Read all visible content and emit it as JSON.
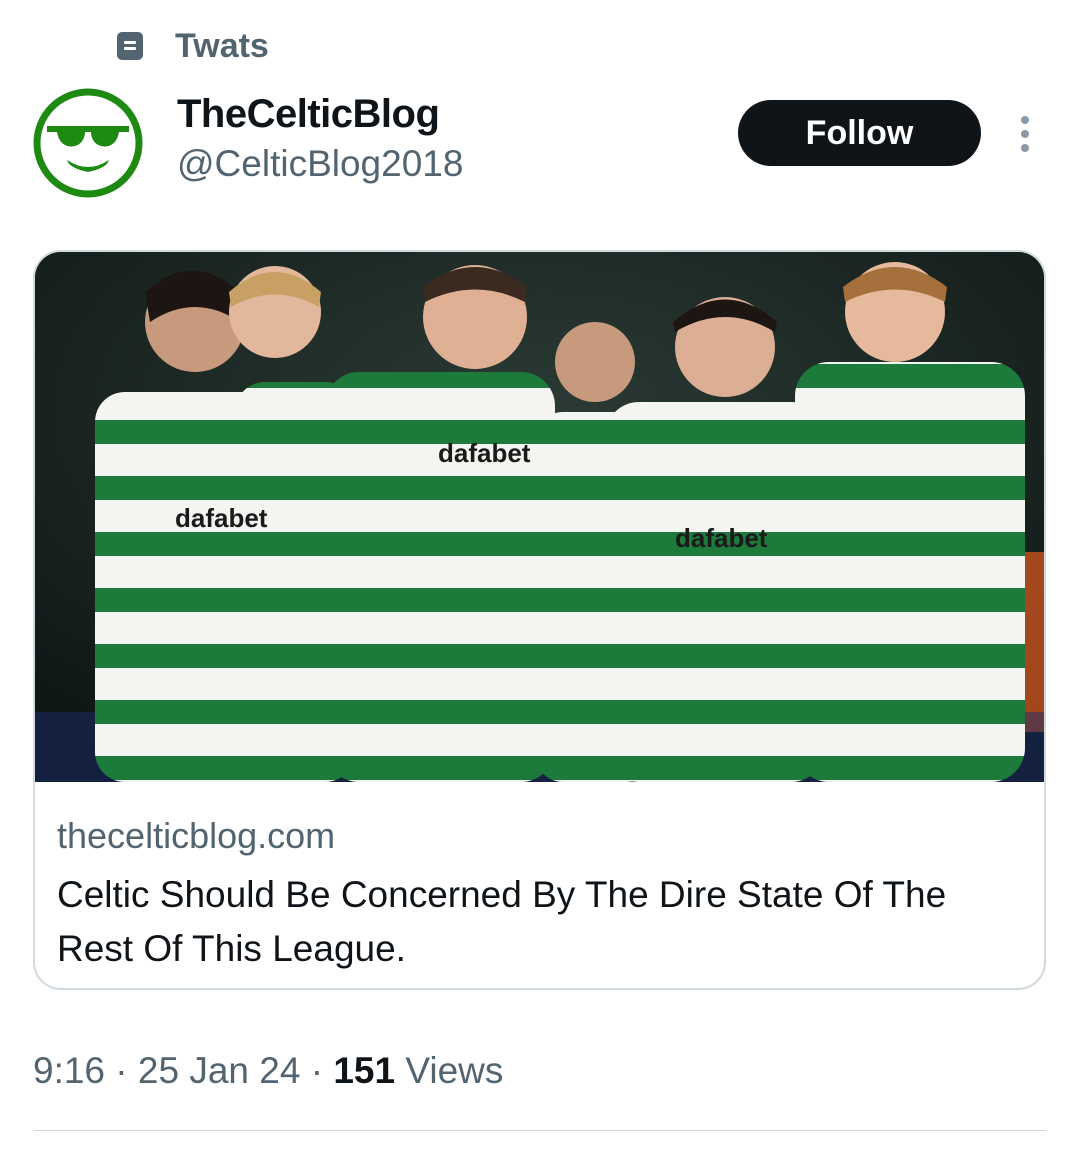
{
  "context": {
    "icon": "list-icon",
    "label": "Twats"
  },
  "author": {
    "display_name": "TheCelticBlog",
    "handle": "@CelticBlog2018",
    "avatar_icon": "sunglasses-smiley-icon",
    "avatar_color": "#1e8a12"
  },
  "actions": {
    "follow_label": "Follow",
    "more_icon": "more-vertical-icon"
  },
  "card": {
    "image_description_icon": "football-team-photo",
    "sponsor_text": "dafabet",
    "domain": "thecelticblog.com",
    "title": "Celtic Should Be Concerned By The Dire State Of The Rest Of This League."
  },
  "meta": {
    "time": "9:16",
    "separator": " · ",
    "date": "25 Jan 24",
    "views_count": "151",
    "views_label": " Views"
  },
  "colors": {
    "text_primary": "#0f1419",
    "text_secondary": "#536471",
    "border": "#cfd9de",
    "celtic_green": "#1c7a3b"
  }
}
